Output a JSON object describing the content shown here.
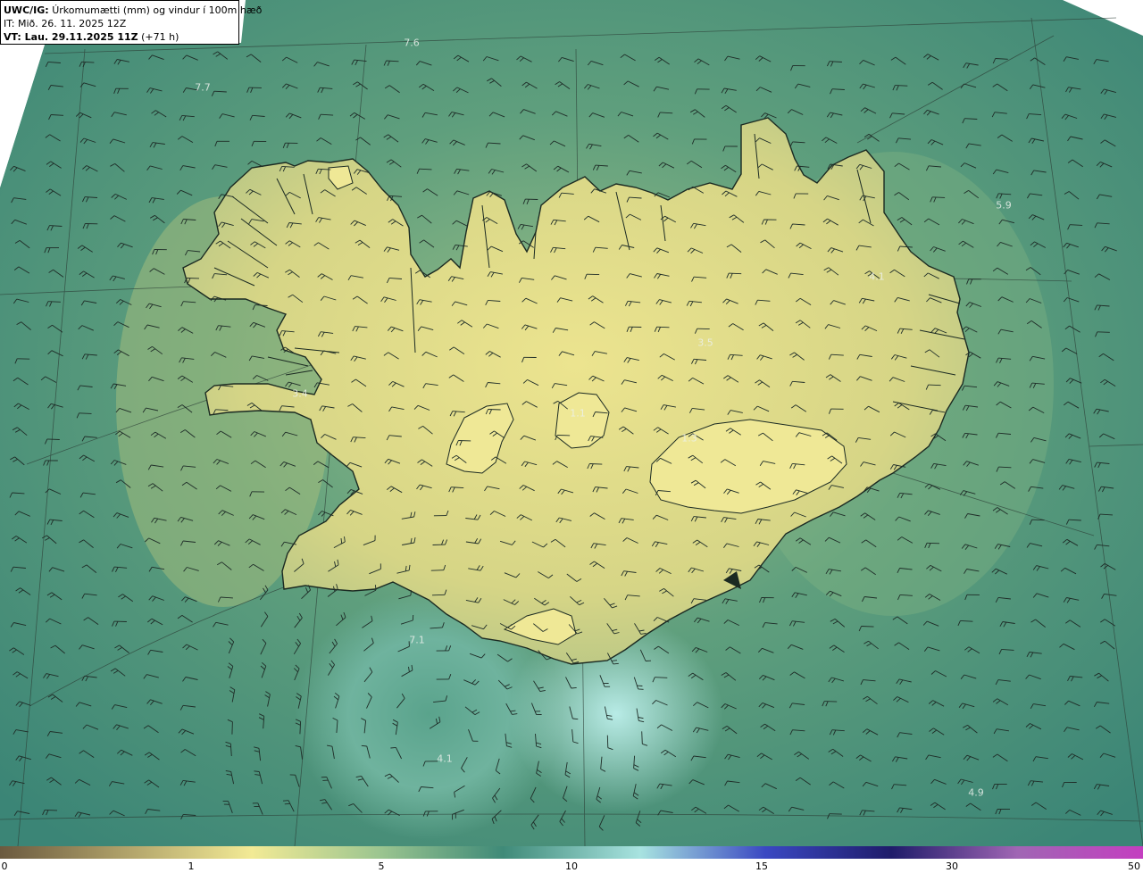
{
  "header": {
    "product": "UWC/IG:",
    "title": "Úrkomumætti (mm) og vindur í 100m hæð",
    "init_time": "IT: Mið. 26. 11. 2025 12Z",
    "valid_prefix": "VT: Lau. 29.11.2025 11Z",
    "valid_suffix": "(+71 h)"
  },
  "point_values": [
    {
      "text": "7.6"
    },
    {
      "text": "7.7"
    },
    {
      "text": "5.9"
    },
    {
      "text": "4.1"
    },
    {
      "text": "3.5"
    },
    {
      "text": "3.4"
    },
    {
      "text": "1.1"
    },
    {
      "text": "1.3"
    },
    {
      "text": "7.1"
    },
    {
      "text": "4.1"
    },
    {
      "text": "4.9"
    }
  ],
  "colorbar": {
    "ticks": [
      "0",
      "1",
      "5",
      "10",
      "15",
      "30",
      "50"
    ],
    "colors": [
      "#6b5a3f",
      "#b0a26a",
      "#f2ea95",
      "#9dc690",
      "#3f8a78",
      "#a8e3e0",
      "#3a48c2",
      "#1f1c6a",
      "#a066b4",
      "#c43ec0"
    ]
  },
  "colors": {
    "ocean": "#3f8a78",
    "land": "#e7dd8e",
    "coast": "#1b2a22",
    "barb": "#1f2d28"
  }
}
